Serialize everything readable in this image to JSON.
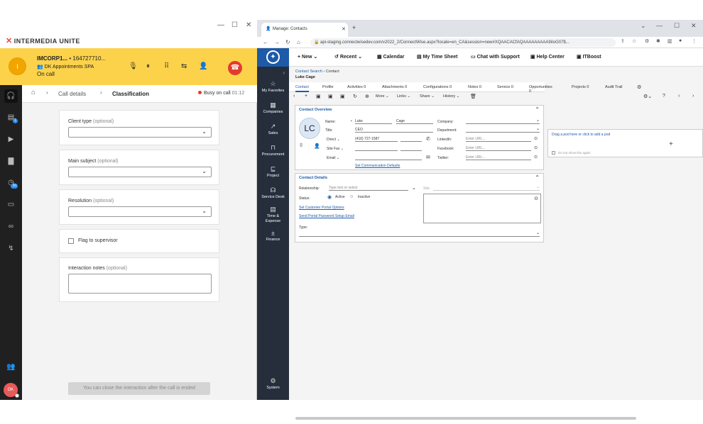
{
  "intermedia": {
    "logo_prefix": "INTERMEDIA",
    "logo_suffix": "UNITE",
    "call": {
      "avatar": "I",
      "name": "IMCORP1...",
      "number": "• 164727710...",
      "queue": "DK Appointments SPA",
      "status": "On call"
    },
    "breadcrumb": {
      "call_details": "Call details",
      "classification": "Classification"
    },
    "busy": {
      "label": "Busy on call",
      "time": "01:12"
    },
    "form": {
      "client_type": "Client type",
      "main_subject": "Main subject",
      "resolution": "Resolution",
      "optional": "(optional)",
      "flag": "Flag to supervisor",
      "notes": "Interaction notes"
    },
    "rail_badges": [
      "1",
      "10"
    ],
    "user_initials": "DK",
    "close_message": "You can close the interaction after the call is ended"
  },
  "browser": {
    "tab_title": "Manage: Contacts",
    "url": "api-staging.connectwisedev.com/v2022_2/ConnectWise.aspx?locale=en_CA&session=new#XQAACACfAQAAAAAAAAA9iIoG07$..."
  },
  "cw": {
    "nav": [
      "My Favorites",
      "Companies",
      "Sales",
      "Procurement",
      "Project",
      "Service Desk",
      "Time &",
      "Expense",
      "Finance",
      "System"
    ],
    "topmenu": {
      "new": "New",
      "recent": "Recent",
      "calendar": "Calendar",
      "timesheet": "My Time Sheet",
      "chat": "Chat with Support",
      "help": "Help Center",
      "itboost": "ITBoost"
    },
    "breadcrumb": {
      "search": "Contact Search",
      "contact": "Contact"
    },
    "page_title": "Luke Cage",
    "tabs": [
      "Contact",
      "Profile",
      "Activities  0",
      "Attachments  0",
      "Configurations  0",
      "Notes  0",
      "Service  0",
      "Opportunities  0",
      "Projects  0",
      "Audit Trail"
    ],
    "toolbar": {
      "more": "More",
      "links": "Links",
      "share": "Share",
      "history": "History"
    },
    "overview": {
      "title": "Contact Overview",
      "initials": "LC",
      "name_label": "Name:",
      "first_name": "Luke",
      "last_name": "Cage",
      "title_label": "Title:",
      "title_value": "CEO",
      "direct_label": "Direct",
      "direct_value": "(416) 727-1587",
      "sitefax_label": "Site Fax",
      "email_label": "Email",
      "company_label": "Company:",
      "department_label": "Department:",
      "linkedin_label": "LinkedIn:",
      "facebook_label": "Facebook:",
      "twitter_label": "Twitter:",
      "url_placeholder": "Enter URL...",
      "comm_link": "Set Communication Defaults"
    },
    "details": {
      "title": "Contact Details",
      "relationship_label": "Relationship:",
      "relationship_placeholder": "Type text or select",
      "site_label": "Site:",
      "status_label": "Status:",
      "active": "Active",
      "inactive": "Inactive",
      "portal_options": "Set Customer Portal Options",
      "portal_password": "Send Portal Password Setup Email",
      "type_label": "Type:"
    },
    "pod": {
      "hint": "Drag a pod here or click to add a pod",
      "checkbox": "Do not show this again"
    }
  }
}
